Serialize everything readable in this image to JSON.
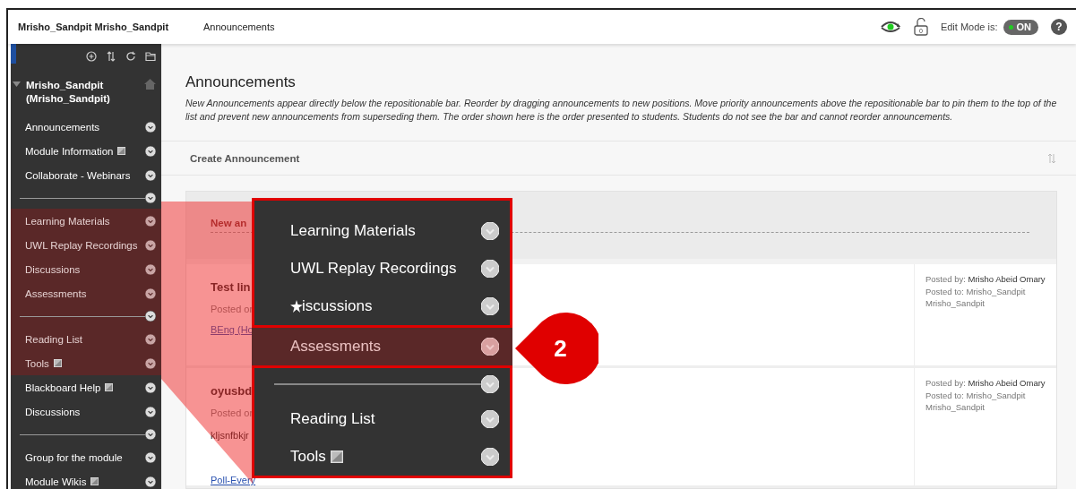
{
  "header": {
    "course_title": "Mrisho_Sandpit Mrisho_Sandpit",
    "breadcrumb": "Announcements",
    "lock_count": "0",
    "edit_mode_label": "Edit Mode is:",
    "edit_mode": {
      "label": "ON",
      "on": true
    },
    "help": "?"
  },
  "sidebar": {
    "course_title": "Mrisho_Sandpit (Mrisho_Sandpit)",
    "items": [
      {
        "kind": "link",
        "label": "Announcements",
        "icon": false,
        "highlighted": false
      },
      {
        "kind": "link",
        "label": "Module Information",
        "icon": true,
        "highlighted": false
      },
      {
        "kind": "link",
        "label": "Collaborate - Webinars",
        "icon": false,
        "highlighted": false
      },
      {
        "kind": "divider",
        "highlighted": false
      },
      {
        "kind": "link",
        "label": "Learning Materials",
        "icon": false,
        "highlighted": true
      },
      {
        "kind": "link",
        "label": "UWL Replay Recordings",
        "icon": false,
        "highlighted": true
      },
      {
        "kind": "link",
        "label": "Discussions",
        "icon": false,
        "highlighted": true
      },
      {
        "kind": "link",
        "label": "Assessments",
        "icon": false,
        "highlighted": true
      },
      {
        "kind": "divider",
        "highlighted": true
      },
      {
        "kind": "link",
        "label": "Reading List",
        "icon": false,
        "highlighted": true
      },
      {
        "kind": "link",
        "label": "Tools",
        "icon": true,
        "highlighted": true
      },
      {
        "kind": "link",
        "label": "Blackboard Help",
        "icon": true,
        "highlighted": false
      },
      {
        "kind": "link",
        "label": "Discussions",
        "icon": false,
        "highlighted": false
      },
      {
        "kind": "divider",
        "highlighted": false
      },
      {
        "kind": "link",
        "label": "Group for the module",
        "icon": false,
        "highlighted": false
      },
      {
        "kind": "link",
        "label": "Module Wikis",
        "icon": true,
        "highlighted": false
      }
    ]
  },
  "main": {
    "title": "Announcements",
    "description": "New Announcements appear directly below the repositionable bar. Reorder by dragging announcements to new positions. Move priority announcements above the repositionable bar to pin them to the top of the list and prevent new announcements from superseding them. The order shown here is the order presented to students. Students do not see the bar and cannot reorder announcements.",
    "create_button": "Create Announcement",
    "separator_label": "New an",
    "announcements": [
      {
        "title": "Test lin",
        "posted_on": "Posted or",
        "body_link": "BEng (Ho",
        "posted_by_label": "Posted by:",
        "posted_by": "Mrisho Abeid Omary",
        "posted_to": "Posted to: Mrisho_Sandpit Mrisho_Sandpit"
      },
      {
        "title": "oyusbd",
        "posted_on": "Posted or",
        "body": "kljsnfbkjr",
        "body_link": "Poll-Every",
        "posted_by_label": "Posted by:",
        "posted_by": "Mrisho Abeid Omary",
        "posted_to": "Posted to: Mrisho_Sandpit Mrisho_Sandpit"
      }
    ]
  },
  "callout": {
    "items": [
      {
        "kind": "link",
        "label": "Learning Materials",
        "icon": false,
        "cursor": false,
        "selected": false
      },
      {
        "kind": "link",
        "label": "UWL Replay Recordings",
        "icon": false,
        "cursor": false,
        "selected": false
      },
      {
        "kind": "link",
        "label": "iscussions",
        "icon": false,
        "cursor": true,
        "selected": false
      },
      {
        "kind": "link",
        "label": "Assessments",
        "icon": false,
        "cursor": false,
        "selected": true
      },
      {
        "kind": "divider"
      },
      {
        "kind": "link",
        "label": "Reading List",
        "icon": false,
        "cursor": false,
        "selected": false
      },
      {
        "kind": "link",
        "label": "Tools",
        "icon": true,
        "cursor": false,
        "selected": false
      }
    ],
    "badge": "2"
  }
}
